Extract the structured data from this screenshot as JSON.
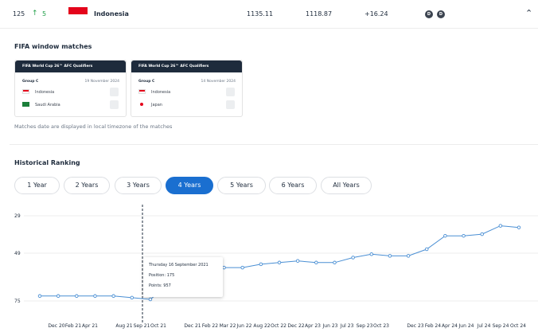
{
  "ranking_row": {
    "rank": "125",
    "change": "5",
    "country": "Indonesia",
    "total_points": "1135.11",
    "previous_points": "1118.87",
    "difference": "+16.24",
    "badges": [
      "D",
      "D"
    ],
    "colors": {
      "up": "#22a04a",
      "flag_red": "#e4041b"
    }
  },
  "fifa_window": {
    "title": "FIFA window matches",
    "matches": [
      {
        "competition": "FIFA World Cup 26™ AFC Qualifiers",
        "group": "Group C",
        "date": "19 November 2024",
        "home": "Indonesia",
        "away": "Saudi Arabia"
      },
      {
        "competition": "FIFA World Cup 26™ AFC Qualifiers",
        "group": "Group C",
        "date": "14 November 2024",
        "home": "Indonesia",
        "away": "Japan"
      }
    ],
    "note": "Matches date are displayed in local timezone of the matches"
  },
  "historical": {
    "title": "Historical Ranking",
    "ranges": [
      "1 Year",
      "2 Years",
      "3 Years",
      "4 Years",
      "5 Years",
      "6 Years",
      "All Years"
    ],
    "active_range": "4 Years",
    "accent": "#1a6fd0"
  },
  "chart_data": {
    "type": "line",
    "title": "",
    "xlabel": "",
    "ylabel": "",
    "y_axis": "rank (inverted)",
    "yticks": [
      "29",
      "49",
      "75"
    ],
    "ylim": [
      175,
      125
    ],
    "xticks": [
      "Dec 20",
      "Feb 21",
      "Apr 21",
      "Aug 21",
      "Sep 21",
      "Oct 21",
      "Dec 21",
      "Feb 22",
      "Mar 22",
      "Jun 22",
      "Aug 22",
      "Oct 22",
      "Dec 22",
      "Apr 23",
      "Jun 23",
      "Jul 23",
      "Sep 23",
      "Oct 23",
      "Dec 23",
      "Feb 24",
      "Apr 24",
      "Jun 24",
      "Jul 24",
      "Sep 24",
      "Oct 24"
    ],
    "series": [
      {
        "color": "#4a8fd4",
        "values": [
          173,
          173,
          173,
          173,
          173,
          174,
          175,
          166,
          165,
          160,
          156,
          156,
          154,
          153,
          152,
          153,
          153,
          150,
          148,
          149,
          149,
          145,
          137,
          137,
          136,
          131,
          132
        ]
      }
    ],
    "tooltip": {
      "date": "Thursday 16 September 2021",
      "position": "Position: 175",
      "points": "Points: 957"
    },
    "grid": true
  }
}
